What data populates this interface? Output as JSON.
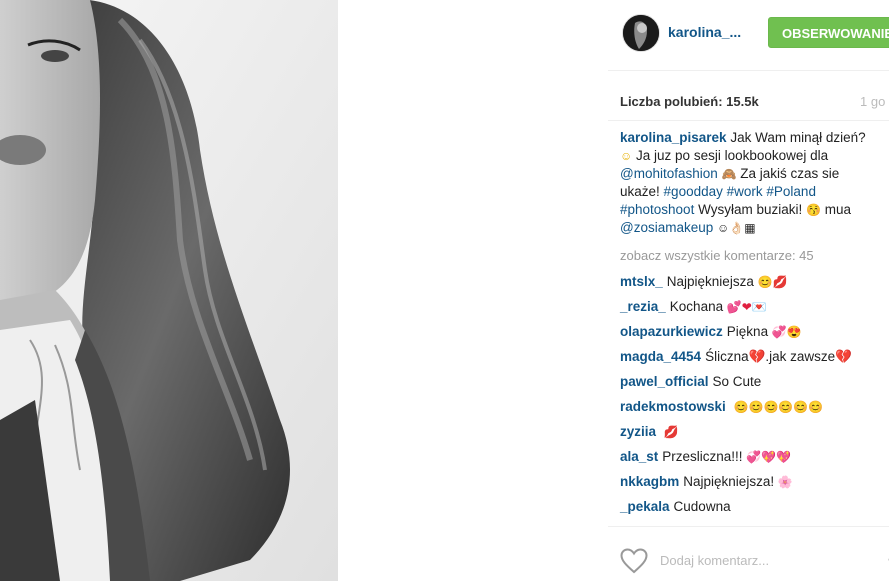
{
  "post": {
    "username": "karolina_...",
    "follow_label": "OBSERWOWANIE",
    "likes_text": "Liczba polubień: 15.5k",
    "time_text": "1 go"
  },
  "caption": {
    "username": "karolina_pisarek",
    "text1": "Jak Wam minął dzień?",
    "text2": "Ja juz po sesji lookbookowej dla",
    "mention1": "@mohitofashion",
    "text3": "Za jakiś czas sie",
    "text4": "ukaże!",
    "tag1": "#goodday",
    "tag2": "#work",
    "tag3": "#Poland",
    "tag4": "#photoshoot",
    "text5": "Wysyłam buziaki!",
    "text6": "mua",
    "mention2": "@zosiamakeup"
  },
  "view_all": "zobacz wszystkie komentarze: 45",
  "comments": [
    {
      "user": "mtslx_",
      "text": "Najpiękniejsza",
      "emoji": "😊💋"
    },
    {
      "user": "_rezia_",
      "text": "Kochana",
      "emoji": "💕❤💌"
    },
    {
      "user": "olapazurkiewicz",
      "text": "Piękna",
      "emoji": "💞😍"
    },
    {
      "user": "magda_4454",
      "text": "Śliczna💔.jak zawsze💔",
      "emoji": ""
    },
    {
      "user": "pawel_official",
      "text": "So Cute",
      "emoji": ""
    },
    {
      "user": "radekmostowski",
      "text": "",
      "emoji": "😊😊😊😊😊😊"
    },
    {
      "user": "zyziia",
      "text": "",
      "emoji": "💋"
    },
    {
      "user": "ala_st",
      "text": "Przesliczna!!!",
      "emoji": "💞💖💖"
    },
    {
      "user": "nkkagbm",
      "text": "Najpiękniejsza!",
      "emoji": "🌸"
    },
    {
      "user": "_pekala",
      "text": "Cudowna",
      "emoji": ""
    }
  ],
  "add_comment_placeholder": "Dodaj komentarz...",
  "more_label": "•••",
  "icons": {
    "heart": "heart-outline-icon",
    "avatar": "avatar"
  }
}
